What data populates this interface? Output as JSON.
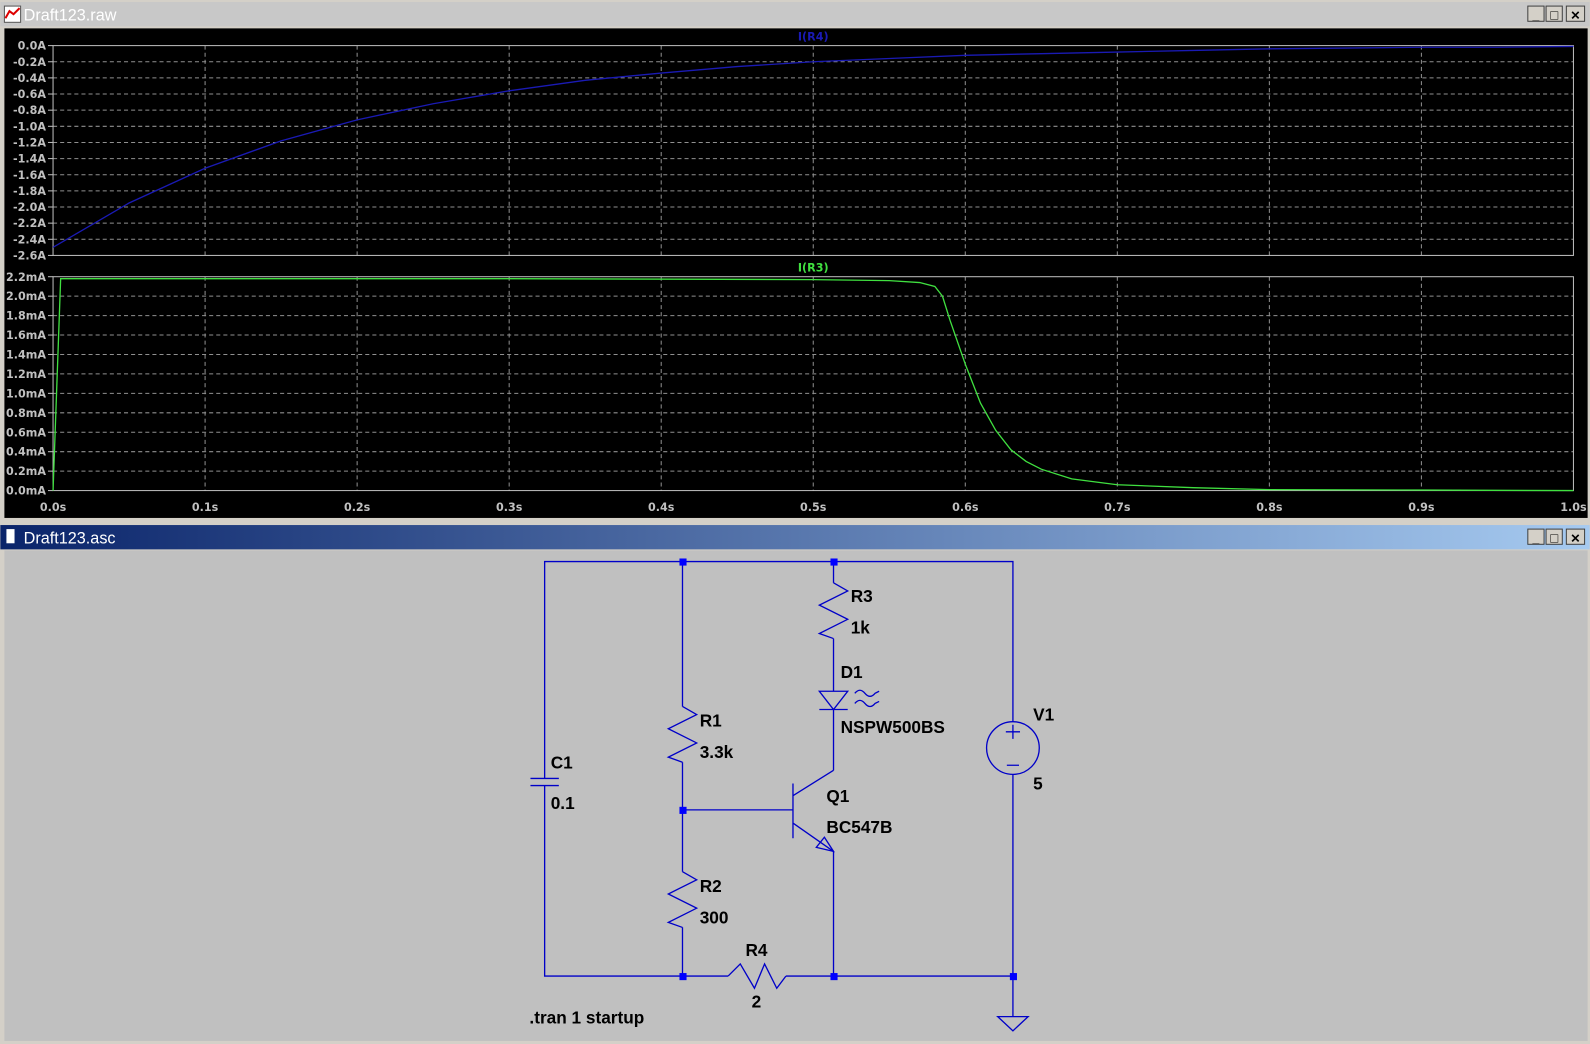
{
  "waveform_window": {
    "title": "Draft123.raw",
    "buttons": {
      "minimize": "_",
      "maximize": "□",
      "close": "✕"
    }
  },
  "schematic_window": {
    "title": "Draft123.asc",
    "buttons": {
      "minimize": "_",
      "maximize": "□",
      "close": "✕"
    }
  },
  "colors": {
    "trace_r4": "#1a1ab4",
    "trace_r3": "#40e040",
    "wire": "#0000c8",
    "plot_bg": "#000000",
    "schematic_bg": "#c0c0c0"
  },
  "chart_data": [
    {
      "type": "line",
      "title": "I(R4)",
      "xlabel": "",
      "ylabel": "",
      "xlim": [
        0,
        1
      ],
      "ylim": [
        -2.6,
        0
      ],
      "xticks": [
        "0.0s",
        "0.1s",
        "0.2s",
        "0.3s",
        "0.4s",
        "0.5s",
        "0.6s",
        "0.7s",
        "0.8s",
        "0.9s",
        "1.0s"
      ],
      "yticks": [
        "0.0A",
        "-0.2A",
        "-0.4A",
        "-0.6A",
        "-0.8A",
        "-1.0A",
        "-1.2A",
        "-1.4A",
        "-1.6A",
        "-1.8A",
        "-2.0A",
        "-2.2A",
        "-2.4A",
        "-2.6A"
      ],
      "grid": true,
      "series": [
        {
          "name": "I(R4)",
          "x": [
            0,
            0.05,
            0.1,
            0.15,
            0.2,
            0.25,
            0.3,
            0.35,
            0.4,
            0.45,
            0.5,
            0.55,
            0.6,
            0.65,
            0.7,
            0.75,
            0.8,
            0.85,
            0.9,
            0.95,
            1.0
          ],
          "y": [
            -2.5,
            -1.95,
            -1.52,
            -1.18,
            -0.92,
            -0.72,
            -0.56,
            -0.43,
            -0.34,
            -0.26,
            -0.2,
            -0.16,
            -0.12,
            -0.1,
            -0.08,
            -0.06,
            -0.04,
            -0.03,
            -0.02,
            -0.02,
            -0.01
          ]
        }
      ]
    },
    {
      "type": "line",
      "title": "I(R3)",
      "xlabel": "",
      "ylabel": "",
      "xlim": [
        0,
        1
      ],
      "ylim": [
        0,
        2.2
      ],
      "yticks": [
        "2.2mA",
        "2.0mA",
        "1.8mA",
        "1.6mA",
        "1.4mA",
        "1.2mA",
        "1.0mA",
        "0.8mA",
        "0.6mA",
        "0.4mA",
        "0.2mA",
        "0.0mA"
      ],
      "grid": true,
      "series": [
        {
          "name": "I(R3)",
          "x": [
            0,
            0.005,
            0.1,
            0.3,
            0.5,
            0.55,
            0.57,
            0.58,
            0.585,
            0.59,
            0.6,
            0.61,
            0.62,
            0.63,
            0.64,
            0.65,
            0.67,
            0.7,
            0.75,
            0.8,
            0.9,
            1.0
          ],
          "y": [
            0,
            2.18,
            2.18,
            2.18,
            2.17,
            2.16,
            2.14,
            2.1,
            2.0,
            1.75,
            1.3,
            0.9,
            0.62,
            0.42,
            0.3,
            0.22,
            0.12,
            0.06,
            0.03,
            0.01,
            0.005,
            0.0
          ]
        }
      ]
    }
  ],
  "schematic": {
    "labels": {
      "c1_name": "C1",
      "c1_value": "0.1",
      "r1_name": "R1",
      "r1_value": "3.3k",
      "r2_name": "R2",
      "r2_value": "300",
      "r3_name": "R3",
      "r3_value": "1k",
      "r4_name": "R4",
      "r4_value": "2",
      "d1_name": "D1",
      "d1_value": "NSPW500BS",
      "q1_name": "Q1",
      "q1_value": "BC547B",
      "v1_name": "V1",
      "v1_value": "5",
      "directive": ".tran 1 startup"
    }
  }
}
